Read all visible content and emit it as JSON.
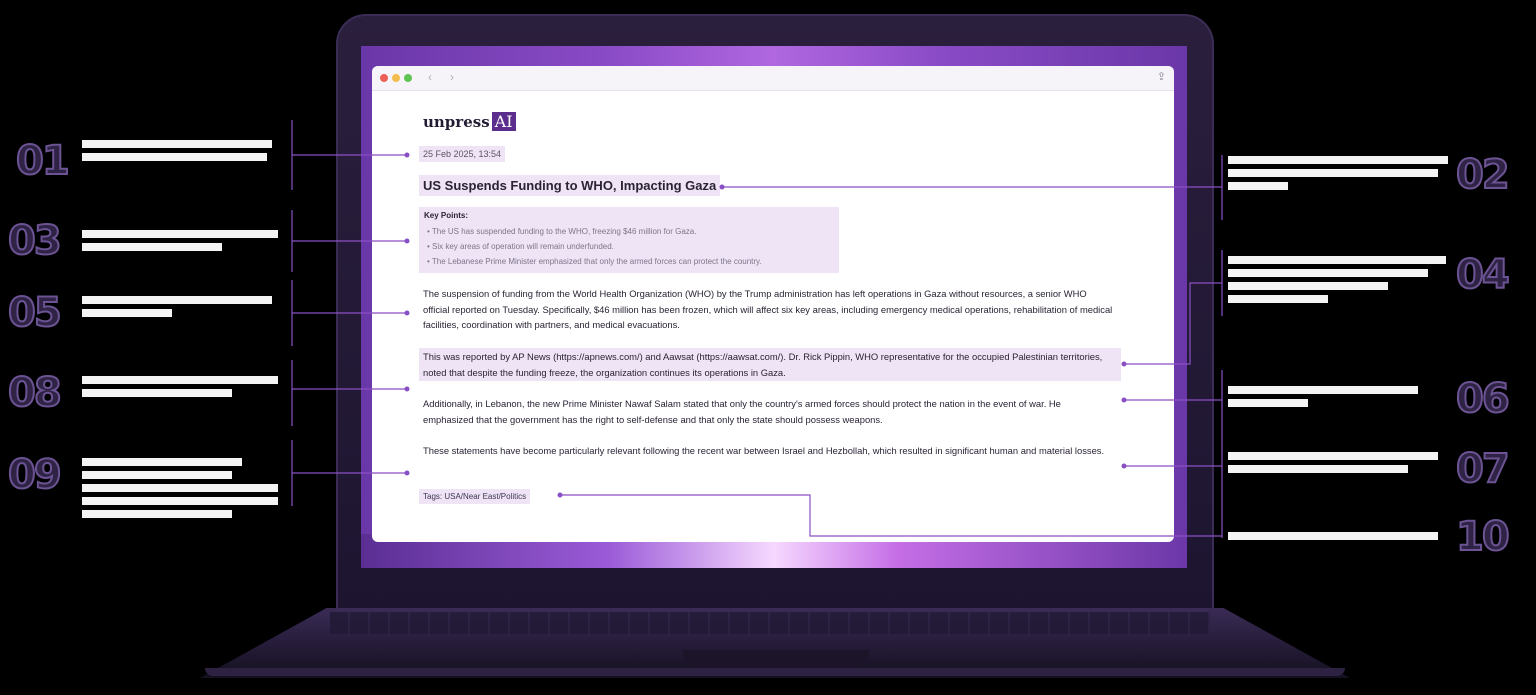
{
  "browser": {
    "nav_back": "‹",
    "nav_forward": "›",
    "share_icon": "⇪"
  },
  "article": {
    "logo_text": "unpress",
    "logo_badge": "AI",
    "date": "25 Feb 2025, 13:54",
    "title": "US Suspends Funding to WHO, Impacting Gaza",
    "key_points_title": "Key Points:",
    "key_points": [
      "• The US has suspended funding to the WHO, freezing $46 million for Gaza.",
      "• Six key areas of operation will remain underfunded.",
      "• The Lebanese Prime Minister emphasized that only the armed forces can protect the country."
    ],
    "paragraphs": [
      "The suspension of funding from the World Health Organization (WHO) by the Trump administration has left operations in Gaza without resources, a senior WHO official reported on Tuesday. Specifically, $46 million has been frozen, which will affect six key areas, including emergency medical operations, rehabilitation of medical facilities, coordination with partners, and medical evacuations.",
      "This was reported by AP News (https://apnews.com/) and Aawsat (https://aawsat.com/). Dr. Rick Pippin, WHO representative for the occupied Palestinian territories, noted that despite the funding freeze, the organization continues its operations in Gaza.",
      "Additionally, in Lebanon, the new Prime Minister Nawaf Salam stated that only the country's armed forces should protect the nation in the event of war. He emphasized that the government has the right to self-defense and that only the state should possess weapons.",
      "These statements have become particularly relevant following the recent war between Israel and Hezbollah, which resulted in significant human and material losses."
    ],
    "tags": "Tags: USA/Near East/Politics"
  },
  "callouts": {
    "left": [
      "01",
      "03",
      "05",
      "08",
      "09"
    ],
    "right": [
      "02",
      "04",
      "06",
      "07",
      "10"
    ]
  },
  "colors": {
    "accent": "#5b2d8c",
    "highlight": "#efe4f6",
    "connector": "#8a4fc4"
  }
}
